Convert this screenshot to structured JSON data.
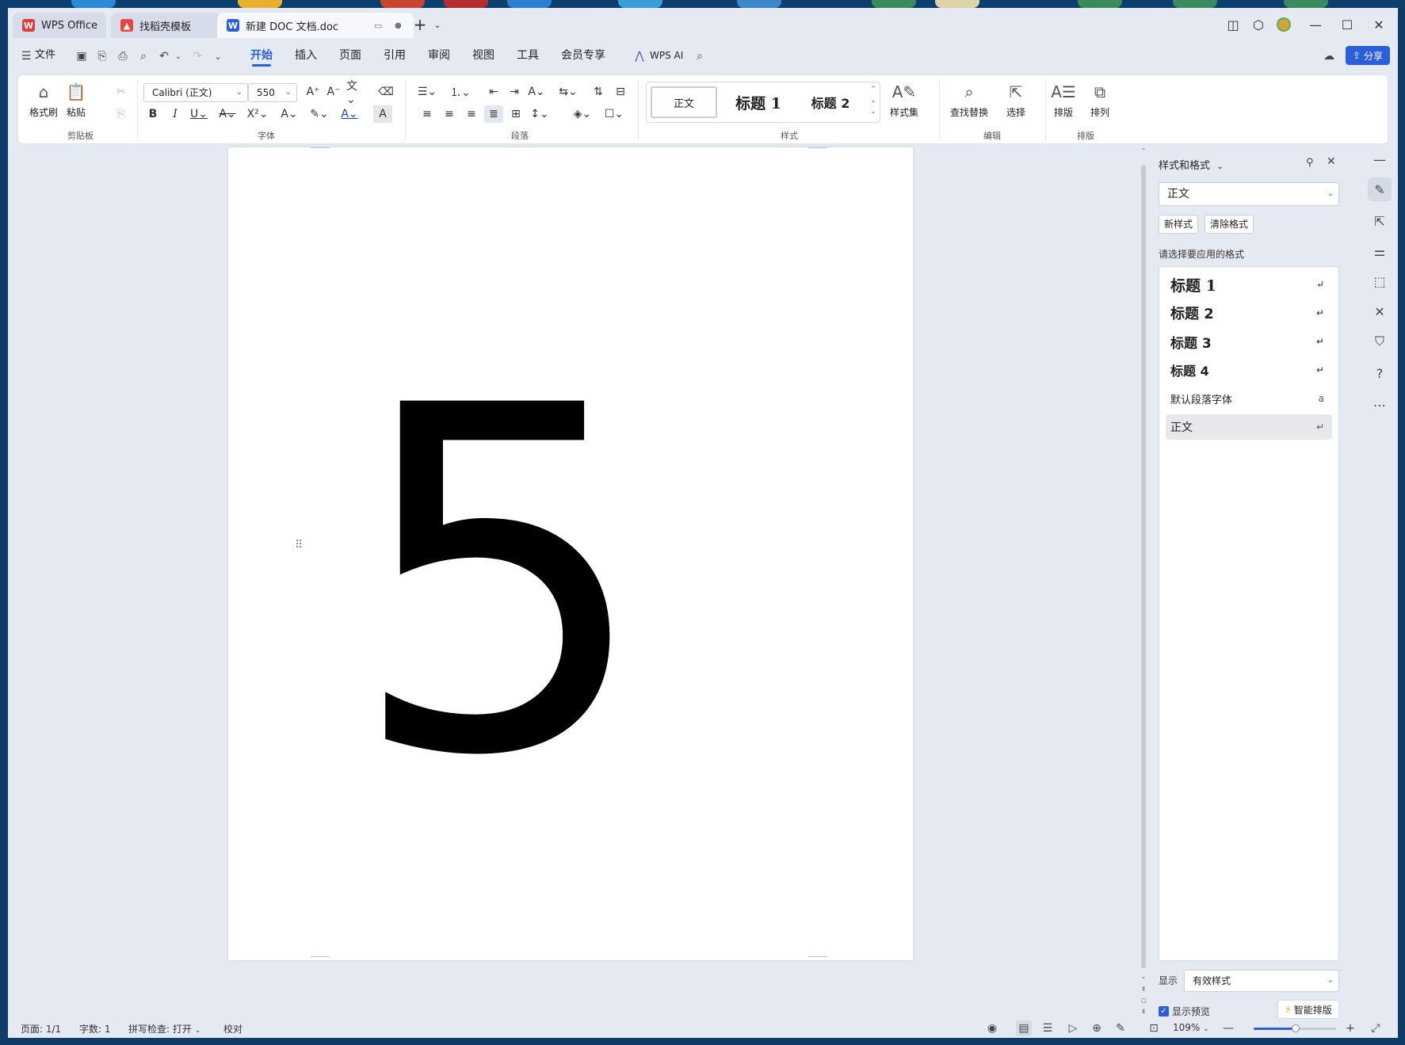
{
  "tabs": [
    {
      "label": "WPS Office"
    },
    {
      "label": "找稻壳模板"
    },
    {
      "label": "新建 DOC 文档.doc"
    }
  ],
  "menu": {
    "file": "文件",
    "items": [
      "开始",
      "插入",
      "页面",
      "引用",
      "审阅",
      "视图",
      "工具",
      "会员专享"
    ],
    "active": "开始",
    "wps_ai": "WPS AI",
    "share": "分享"
  },
  "ribbon": {
    "clipboard": {
      "format_painter": "格式刷",
      "paste": "粘贴",
      "group": "剪贴板"
    },
    "font": {
      "name": "Calibri (正文)",
      "size": "550",
      "group": "字体"
    },
    "paragraph": {
      "group": "段落"
    },
    "styles": {
      "gallery": [
        "正文",
        "标题 1",
        "标题 2"
      ],
      "style_set": "样式集",
      "group": "样式"
    },
    "edit": {
      "find_replace": "查找替换",
      "select": "选择",
      "group": "编辑"
    },
    "layout": {
      "typeset": "排版",
      "arrange": "排列",
      "group": "排版"
    }
  },
  "document": {
    "content": "5"
  },
  "style_pane": {
    "title": "样式和格式",
    "current": "正文",
    "new_style": "新样式",
    "clear_format": "清除格式",
    "prompt": "请选择要应用的格式",
    "items": [
      {
        "label": "标题 1",
        "marker": "↵"
      },
      {
        "label": "标题 2",
        "marker": "↵"
      },
      {
        "label": "标题 3",
        "marker": "↵"
      },
      {
        "label": "标题 4",
        "marker": "↵"
      },
      {
        "label": "默认段落字体",
        "marker": "a"
      },
      {
        "label": "正文",
        "marker": "↵"
      }
    ],
    "show_label": "显示",
    "show_value": "有效样式",
    "preview_label": "显示预览",
    "preview_checked": true,
    "smart_layout": "智能排版"
  },
  "status": {
    "page": "页面: 1/1",
    "words": "字数: 1",
    "spell": "拼写检查: 打开",
    "proof": "校对",
    "zoom": "109%"
  },
  "colors": {
    "accent": "#2b5fd9",
    "window_bg": "#e4e9f2",
    "desktop": "#0e3b68"
  }
}
